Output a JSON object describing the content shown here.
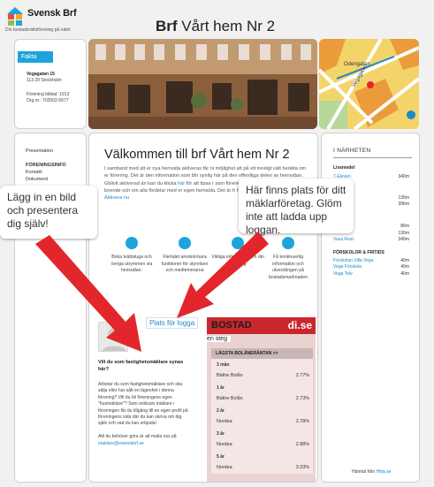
{
  "header": {
    "logo_name": "Svensk Brf",
    "logo_tagline": "Din bostadsrättsförening på nätet",
    "title_bold": "Brf",
    "title_rest": " Vårt hem Nr 2",
    "logo_colors": [
      "#e84c3d",
      "#f5a623",
      "#1ea4dd",
      "#8bc34a"
    ]
  },
  "fakta": {
    "tab": "Fakta",
    "street": "Vegagatan 15",
    "city": "113 29 Stockholm",
    "founded": "Förening bildad: 1913",
    "orgnr": "Org.nr.: 702002-5677"
  },
  "nav": {
    "items": [
      "Presentation",
      "FÖRENINGSINFO",
      "Kontakt",
      "Dokument"
    ]
  },
  "main": {
    "title": "Välkommen till brf Vårt hem Nr 2",
    "intro_1": "I samband med att er nya hemsida aktiveras får ni möjlighet att på ett trevligt sätt berätta om er förening. Det är den information som blir synlig här på den offentliga delen av hemsidan. G",
    "intro_2": "blivit aktiverad än kan du klicka ",
    "intro_link": "här",
    "intro_3": " för att tipsa r som förenklar vardagen för dig som boende och om alla fördelar med er egen hemsida. Det är h hemsida hos Svensk Brf. ",
    "intro_link_2": "Aktivera nu",
    "features": [
      "Boka tvättstuga och övriga utrymmen via hemsidan.",
      "Flertalet använd-bara funktioner för styrelsen och medlemmarna",
      "Viktiga information om din förening",
      "Få kontinuerlig information och utvecklingen på bostadsmarknaden"
    ],
    "logo_placeholder": "Plats för logga",
    "question_title": "Vill du som fastighetsmäklare synas här?",
    "question_body": "Arbetar du som fastighetsmäklare och ska sälja eller har sålt en lägenhet i denna förening? Vill du bli föreningens egen \"husmäklare\"? Som exklusiv mäklare i föreningen får du tillgång till en egen profil på föreningens sida där du kan skriva om dig själv och vad du kan erbjuda!",
    "question_footer": "Allt du behöver göra är att maila oss på ",
    "question_mail": "maklare@svenskbrf.se"
  },
  "ad": {
    "brand_left": "BOSTAD",
    "brand_right": "di.se",
    "sub": "en steg",
    "table_head": "LÄGSTA BOLÅNERÄNTAN >>",
    "rates": [
      {
        "term": "3 mån",
        "bank": "Bättre Bolån",
        "rate": "2.77%"
      },
      {
        "term": "1 år",
        "bank": "Bättre Bolån",
        "rate": "2.73%"
      },
      {
        "term": "2 år",
        "bank": "Nordea",
        "rate": "2.78%"
      },
      {
        "term": "3 år",
        "bank": "Nordea",
        "rate": "2.88%"
      },
      {
        "term": "5 år",
        "bank": "Nordea",
        "rate": "3.33%"
      }
    ]
  },
  "nearby": {
    "title": "I NÄRHETEN",
    "groups": [
      {
        "heading": "Livsmedel",
        "rows": [
          {
            "name": "7-Eleven",
            "dist": "340m"
          },
          {
            "name": "",
            "dist": "135m"
          },
          {
            "name": "",
            "dist": "396m"
          },
          {
            "name": "",
            "dist": "86m"
          },
          {
            "name": "",
            "dist": "130m"
          },
          {
            "name": "Vasa Real",
            "dist": "349m"
          }
        ]
      },
      {
        "heading": "FÖRSKOLOR & FRITIDS",
        "rows": [
          {
            "name": "Förskolan Villa Vega",
            "dist": "40m"
          },
          {
            "name": "Vega Förskola",
            "dist": "40m"
          },
          {
            "name": "Vega Tolv",
            "dist": "40m"
          }
        ]
      }
    ],
    "footer": "Hämtat från ",
    "footer_link": "Hitta.se"
  },
  "callouts": {
    "left": "Lägg in en bild och presentera dig själv!",
    "right": "Här finns plats för ditt mäklarföretag. Glöm inte att ladda upp loggan."
  },
  "map_labels": [
    "Odengatan",
    "Vegagatan"
  ],
  "colors": {
    "accent": "#1ea4dd",
    "link": "#1e88c9",
    "arrow": "#e2262b",
    "ad_red": "#c9272d"
  }
}
